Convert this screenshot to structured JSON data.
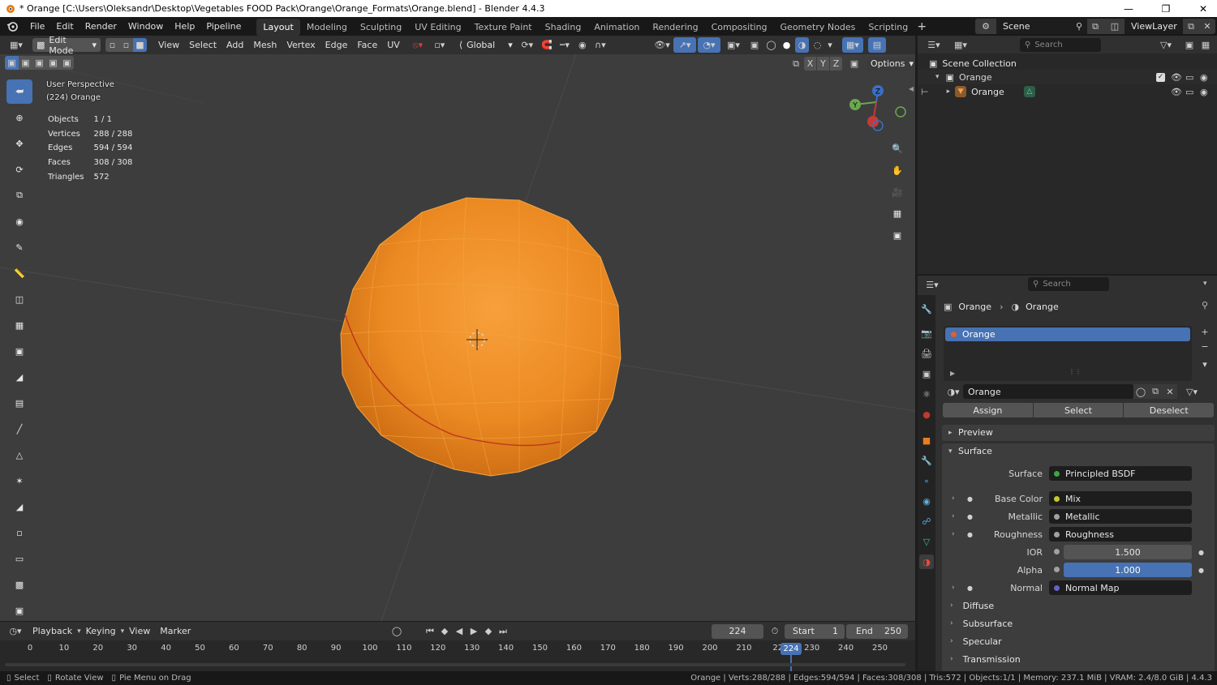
{
  "titlebar": {
    "title": "* Orange [C:\\Users\\Oleksandr\\Desktop\\Vegetables FOOD Pack\\Orange\\Orange_Formats\\Orange.blend] - Blender 4.4.3"
  },
  "menubar": {
    "menus": [
      "File",
      "Edit",
      "Render",
      "Window",
      "Help",
      "Pipeline"
    ],
    "workspaces": [
      "Layout",
      "Modeling",
      "Sculpting",
      "UV Editing",
      "Texture Paint",
      "Shading",
      "Animation",
      "Rendering",
      "Compositing",
      "Geometry Nodes",
      "Scripting"
    ],
    "active_workspace": "Layout",
    "scene": "Scene",
    "view_layer": "ViewLayer"
  },
  "viewport_header": {
    "mode": "Edit Mode",
    "menus": [
      "View",
      "Select",
      "Add",
      "Mesh",
      "Vertex",
      "Edge",
      "Face",
      "UV"
    ],
    "orientation": "Global",
    "options_label": "Options",
    "axes": [
      "X",
      "Y",
      "Z"
    ]
  },
  "viewport": {
    "view_name": "User Perspective",
    "object_label": "(224) Orange",
    "stats": [
      {
        "label": "Objects",
        "value": "1 / 1"
      },
      {
        "label": "Vertices",
        "value": "288 / 288"
      },
      {
        "label": "Edges",
        "value": "594 / 594"
      },
      {
        "label": "Faces",
        "value": "308 / 308"
      },
      {
        "label": "Triangles",
        "value": "572"
      }
    ],
    "gizmo_axes": [
      "X",
      "Y",
      "Z"
    ]
  },
  "timeline": {
    "menus": [
      "Playback",
      "Keying",
      "View",
      "Marker"
    ],
    "current_frame": "224",
    "start_label": "Start",
    "start": "1",
    "end_label": "End",
    "end": "250",
    "ticks": [
      "0",
      "10",
      "20",
      "30",
      "40",
      "50",
      "60",
      "70",
      "80",
      "90",
      "100",
      "110",
      "120",
      "130",
      "140",
      "150",
      "160",
      "170",
      "180",
      "190",
      "200",
      "210",
      "22",
      "230",
      "240",
      "250"
    ],
    "playhead": "224"
  },
  "statusbar": {
    "hints": [
      "Select",
      "Rotate View",
      "Pie Menu on Drag"
    ],
    "info": "Orange | Verts:288/288 | Edges:594/594 | Faces:308/308 | Tris:572 | Objects:1/1 | Memory: 237.1 MiB | VRAM: 2.4/8.0 GiB | 4.4.3"
  },
  "outliner": {
    "search_placeholder": "Search",
    "root": "Scene Collection",
    "collection": "Orange",
    "object": "Orange"
  },
  "properties": {
    "search_placeholder": "Search",
    "breadcrumb": [
      "Orange",
      "Orange"
    ],
    "material_slot": "Orange",
    "material_name": "Orange",
    "buttons": {
      "assign": "Assign",
      "select": "Select",
      "deselect": "Deselect"
    },
    "sections": {
      "preview": "Preview",
      "surface": "Surface"
    },
    "surface_rows": [
      {
        "label": "Surface",
        "value": "Principled BSDF",
        "dot": "#3fa63f"
      },
      {
        "label": "Base Color",
        "value": "Mix",
        "dot": "#c7c729"
      },
      {
        "label": "Metallic",
        "value": "Metallic",
        "dot": "#a1a1a1"
      },
      {
        "label": "Roughness",
        "value": "Roughness",
        "dot": "#a1a1a1"
      },
      {
        "label": "IOR",
        "value": "1.500",
        "dot": "#a1a1a1"
      },
      {
        "label": "Alpha",
        "value": "1.000",
        "dot": "#a1a1a1"
      },
      {
        "label": "Normal",
        "value": "Normal Map",
        "dot": "#6363c7"
      }
    ],
    "subsections": [
      "Diffuse",
      "Subsurface",
      "Specular",
      "Transmission"
    ]
  },
  "colors": {
    "accent": "#4772b3",
    "orange": "#e88a2a",
    "header": "#303030",
    "viewport_bg": "#3d3d3d"
  }
}
